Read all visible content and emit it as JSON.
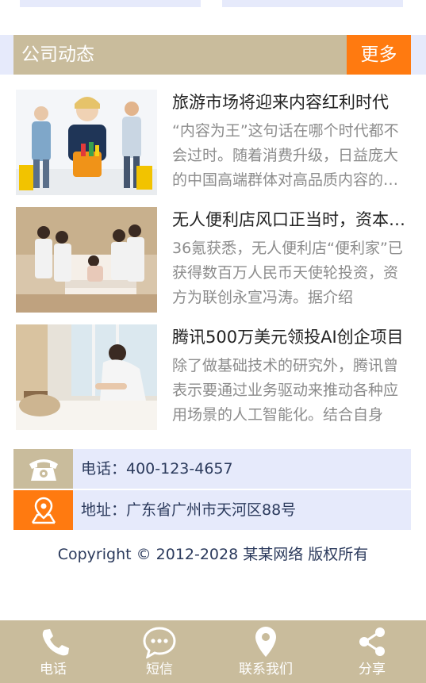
{
  "section": {
    "title": "公司动态",
    "more_label": "更多"
  },
  "news": [
    {
      "title": "旅游市场将迎来内容红利时代",
      "desc": "“内容为王”这句话在哪个时代都不会过时。随着消费升级，日益庞大的中国高端群体对高品质内容的需求"
    },
    {
      "title": "无人便利店风口正当时，资本纷纷入局",
      "desc": "36氪获悉，无人便利店“便利家”已获得数百万人民币天使轮投资，资方为联创永宣冯涛。据介绍"
    },
    {
      "title": "腾讯500万美元领投AI创企项目",
      "desc": "除了做基础技术的研究外，腾讯曾表示要通过业务驱动来推动各种应用场景的人工智能化。结合自身"
    }
  ],
  "contact": {
    "phone": "电话：400-123-4657",
    "address": "地址：广东省广州市天河区88号",
    "phone_icon": "phone-icon",
    "address_icon": "map-pin-icon"
  },
  "footer": {
    "copyright": "Copyright © 2012-2028 某某网络 版权所有"
  },
  "bottom_nav": [
    {
      "label": "电话",
      "icon": "phone-icon"
    },
    {
      "label": "短信",
      "icon": "message-icon"
    },
    {
      "label": "联系我们",
      "icon": "location-icon"
    },
    {
      "label": "分享",
      "icon": "share-icon"
    }
  ],
  "colors": {
    "accent": "#ff7a10",
    "header": "#c9bc9c",
    "light": "#e6eafb"
  }
}
